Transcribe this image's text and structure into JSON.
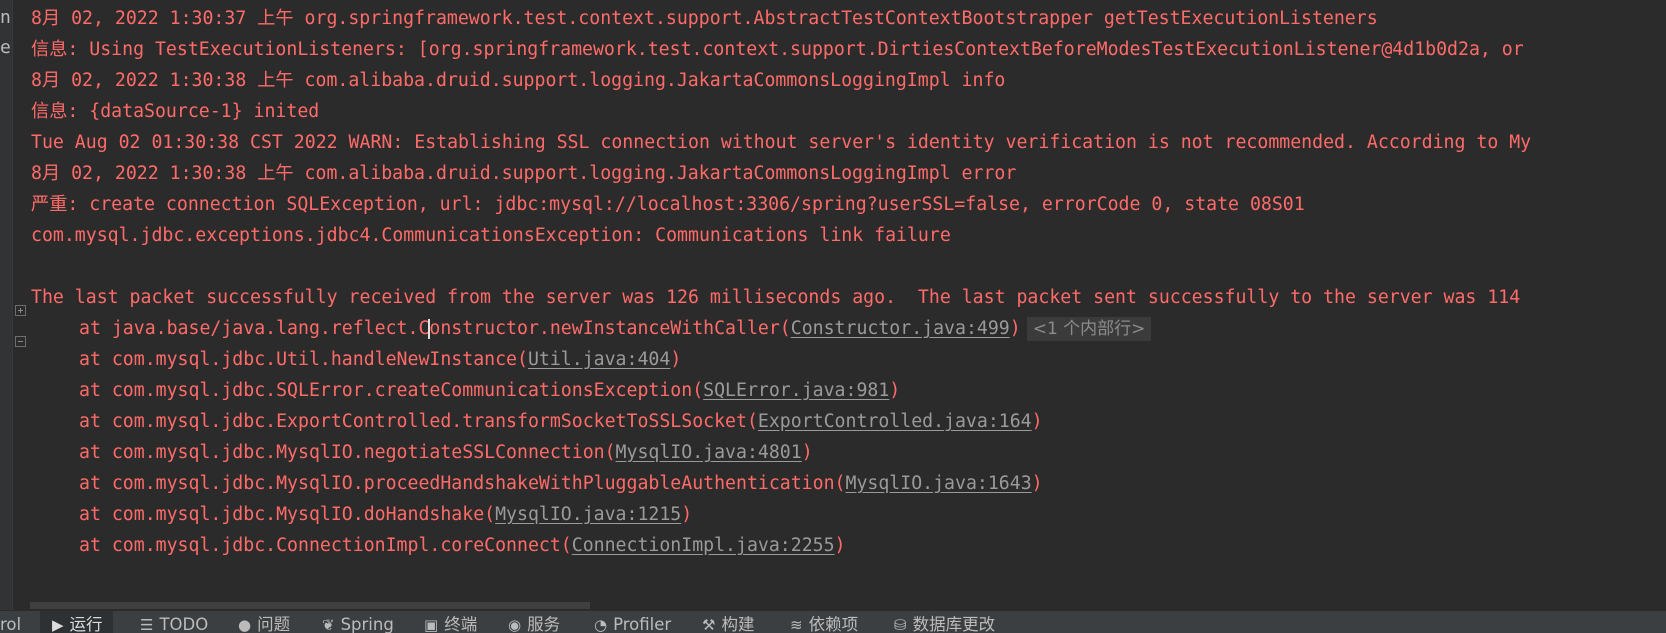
{
  "left_panel": {
    "fragment_1": "ns",
    "fragment_2": "e"
  },
  "console": {
    "lines": [
      "8月 02, 2022 1:30:37 上午 org.springframework.test.context.support.AbstractTestContextBootstrapper getTestExecutionListeners",
      "信息: Using TestExecutionListeners: [org.springframework.test.context.support.DirtiesContextBeforeModesTestExecutionListener@4d1b0d2a, or",
      "8月 02, 2022 1:30:38 上午 com.alibaba.druid.support.logging.JakartaCommonsLoggingImpl info",
      "信息: {dataSource-1} inited",
      "Tue Aug 02 01:30:38 CST 2022 WARN: Establishing SSL connection without server's identity verification is not recommended. According to My",
      "8月 02, 2022 1:30:38 上午 com.alibaba.druid.support.logging.JakartaCommonsLoggingImpl error",
      "严重: create connection SQLException, url: jdbc:mysql://localhost:3306/spring?userSSL=false, errorCode 0, state 08S01",
      "com.mysql.jdbc.exceptions.jdbc4.CommunicationsException: Communications link failure",
      "The last packet successfully received from the server was 126 milliseconds ago.  The last packet sent successfully to the server was 114"
    ],
    "trace": [
      {
        "prefix_a": "at java.base/java.lang.reflect.C",
        "prefix_b": "onstructor.newInstanceWithCaller(",
        "link": "Constructor.java:499",
        "suffix": ")",
        "folded": "<1 个内部行>"
      },
      {
        "prefix": "at com.mysql.jdbc.Util.handleNewInstance(",
        "link": "Util.java:404",
        "suffix": ")"
      },
      {
        "prefix": "at com.mysql.jdbc.SQLError.createCommunicationsException(",
        "link": "SQLError.java:981",
        "suffix": ")"
      },
      {
        "prefix": "at com.mysql.jdbc.ExportControlled.transformSocketToSSLSocket(",
        "link": "ExportControlled.java:164",
        "suffix": ")"
      },
      {
        "prefix": "at com.mysql.jdbc.MysqlIO.negotiateSSLConnection(",
        "link": "MysqlIO.java:4801",
        "suffix": ")"
      },
      {
        "prefix": "at com.mysql.jdbc.MysqlIO.proceedHandshakeWithPluggableAuthentication(",
        "link": "MysqlIO.java:1643",
        "suffix": ")"
      },
      {
        "prefix": "at com.mysql.jdbc.MysqlIO.doHandshake(",
        "link": "MysqlIO.java:1215",
        "suffix": ")"
      },
      {
        "prefix": "at com.mysql.jdbc.ConnectionImpl.coreConnect(",
        "link": "ConnectionImpl.java:2255",
        "suffix": ")"
      }
    ]
  },
  "toolbar": {
    "items": [
      {
        "label": "rol",
        "icon": ""
      },
      {
        "label": "运行",
        "icon": "▶"
      },
      {
        "label": "TODO",
        "icon": "☰"
      },
      {
        "label": "问题",
        "icon": "●"
      },
      {
        "label": "Spring",
        "icon": "❦"
      },
      {
        "label": "终端",
        "icon": "▣"
      },
      {
        "label": "服务",
        "icon": "◉"
      },
      {
        "label": "Profiler",
        "icon": "◔"
      },
      {
        "label": "构建",
        "icon": "⚒"
      },
      {
        "label": "依赖项",
        "icon": "≋"
      },
      {
        "label": "数据库更改",
        "icon": "⛁"
      }
    ]
  }
}
